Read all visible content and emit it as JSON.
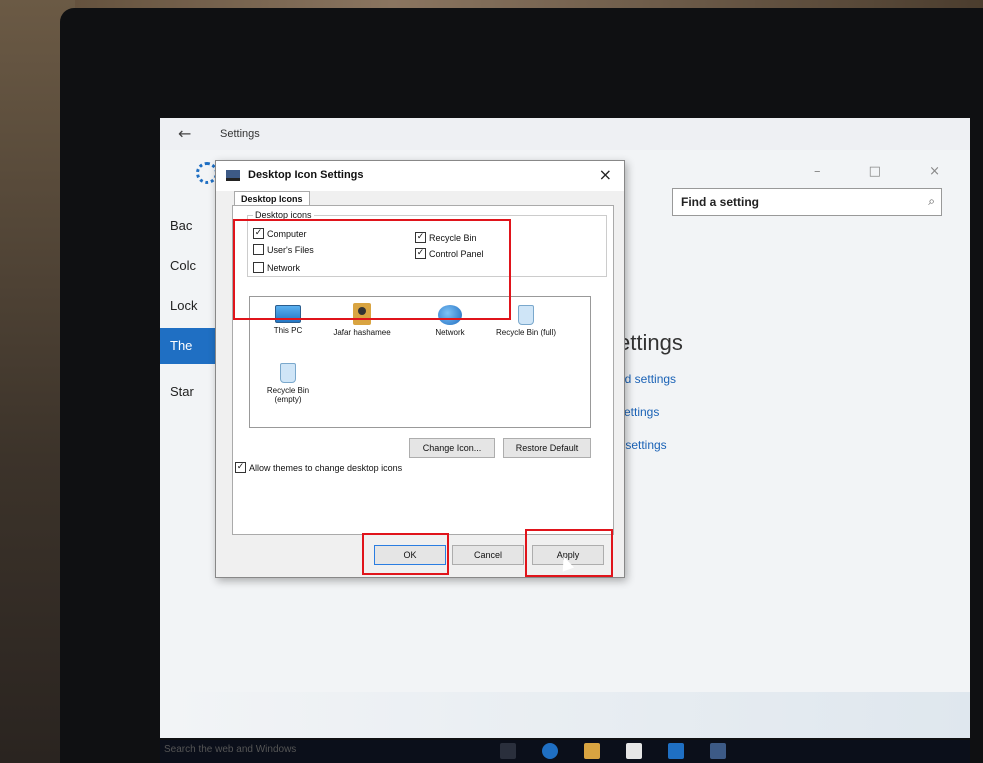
{
  "settings": {
    "title": "Settings",
    "search_placeholder": "Find a setting",
    "nav": [
      "Bac",
      "Colc",
      "Lock",
      "The",
      "Star"
    ],
    "right_heading": "ettings",
    "right_links": [
      "s",
      "nd settings",
      "settings",
      "r settings"
    ],
    "window_controls": "– □ ×"
  },
  "dialog": {
    "title": "Desktop Icon Settings",
    "close": "×",
    "tab": "Desktop Icons",
    "group_label": "Desktop icons",
    "checkboxes": [
      {
        "label": "Computer",
        "checked": true
      },
      {
        "label": "User's Files",
        "checked": false
      },
      {
        "label": "Network",
        "checked": false
      },
      {
        "label": "Recycle Bin",
        "checked": true
      },
      {
        "label": "Control Panel",
        "checked": true
      }
    ],
    "icons": [
      {
        "label": "This PC",
        "icon": "pc-icon"
      },
      {
        "label": "Jafar hashamee",
        "icon": "user-folder-icon"
      },
      {
        "label": "Network",
        "icon": "network-icon"
      },
      {
        "label": "Recycle Bin (full)",
        "icon": "recycle-bin-full-icon"
      },
      {
        "label": "Recycle Bin (empty)",
        "icon": "recycle-bin-empty-icon"
      }
    ],
    "change_icon": "Change Icon...",
    "restore_default": "Restore Default",
    "allow_themes": {
      "label": "Allow themes to change desktop icons",
      "checked": true
    },
    "ok": "OK",
    "cancel": "Cancel",
    "apply": "Apply"
  },
  "check_mark": "✓",
  "taskbar": {
    "search_text": "Search the web and Windows"
  },
  "colors": {
    "accent": "#1f6fc3",
    "highlight": "#e0141b"
  }
}
